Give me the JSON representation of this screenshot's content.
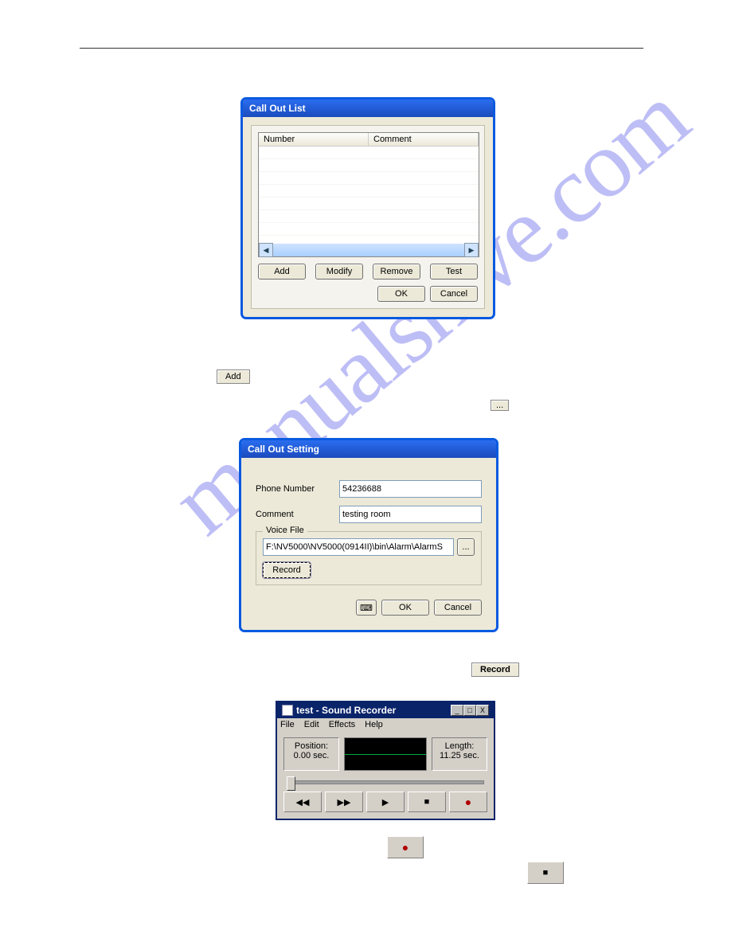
{
  "callOutList": {
    "title": "Call Out List",
    "columns": {
      "number": "Number",
      "comment": "Comment"
    },
    "buttons": {
      "add": "Add",
      "modify": "Modify",
      "remove": "Remove",
      "test": "Test",
      "ok": "OK",
      "cancel": "Cancel"
    }
  },
  "floating": {
    "add": "Add",
    "ellipsis": "...",
    "record": "Record"
  },
  "callOutSetting": {
    "title": "Call Out Setting",
    "labels": {
      "phone": "Phone Number",
      "comment": "Comment",
      "voiceFile": "Voice File"
    },
    "values": {
      "phone": "54236688",
      "comment": "testing room",
      "path": "F:\\NV5000\\NV5000(0914II)\\bin\\Alarm\\AlarmS"
    },
    "buttons": {
      "record": "Record",
      "ellipsis": "...",
      "ok": "OK",
      "cancel": "Cancel"
    }
  },
  "recorder": {
    "title": "test - Sound Recorder",
    "menu": {
      "file": "File",
      "edit": "Edit",
      "effects": "Effects",
      "help": "Help"
    },
    "positionLabel": "Position:",
    "positionValue": "0.00 sec.",
    "lengthLabel": "Length:",
    "lengthValue": "11.25 sec.",
    "winIcons": {
      "min": "_",
      "max": "□",
      "close": "X"
    }
  },
  "glyphs": {
    "seekBack": "◀◀",
    "seekFwd": "▶▶",
    "play": "▶",
    "stop": "■",
    "record": "●",
    "keyboard": "⌨"
  }
}
